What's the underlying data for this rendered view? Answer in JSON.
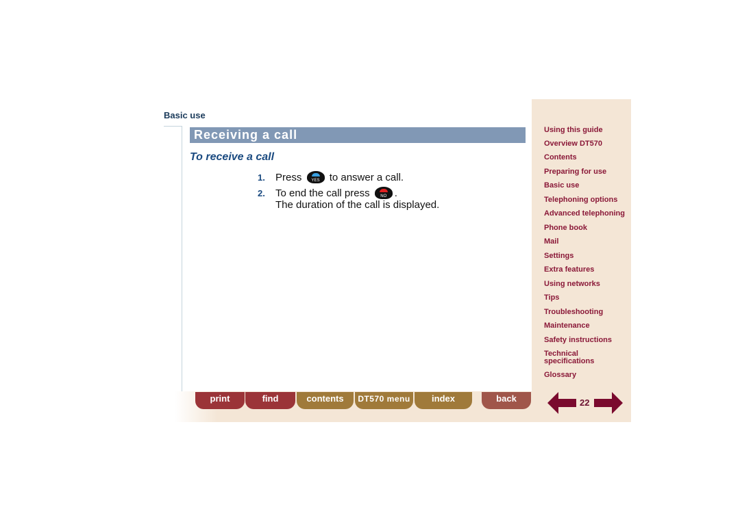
{
  "header": {
    "section": "Basic use"
  },
  "main": {
    "title": "Receiving a call",
    "subtitle": "To receive a call",
    "steps": [
      {
        "num": "1.",
        "before": "Press",
        "key": "YES",
        "after": "to answer a call."
      },
      {
        "num": "2.",
        "before": "To end the call press",
        "key": "NO",
        "after": ".",
        "line2": "The duration of the call is displayed."
      }
    ]
  },
  "sidebar": {
    "items": [
      "Using this guide",
      "Overview DT570",
      "Contents",
      "Preparing for use",
      "Basic use",
      "Telephoning options",
      "Advanced telephoning",
      "Phone book",
      "Mail",
      "Settings",
      "Extra features",
      "Using networks",
      "Tips",
      "Troubleshooting",
      "Maintenance",
      "Safety instructions",
      "Technical specifications",
      "Glossary"
    ]
  },
  "footer": {
    "print": "print",
    "find": "find",
    "contents": "contents",
    "menu": "DT570 menu",
    "index": "index",
    "back": "back",
    "page": "22"
  },
  "colors": {
    "link": "#8a1838",
    "title_bar": "#8198b5",
    "sidebar_bg": "#f4e6d6"
  }
}
